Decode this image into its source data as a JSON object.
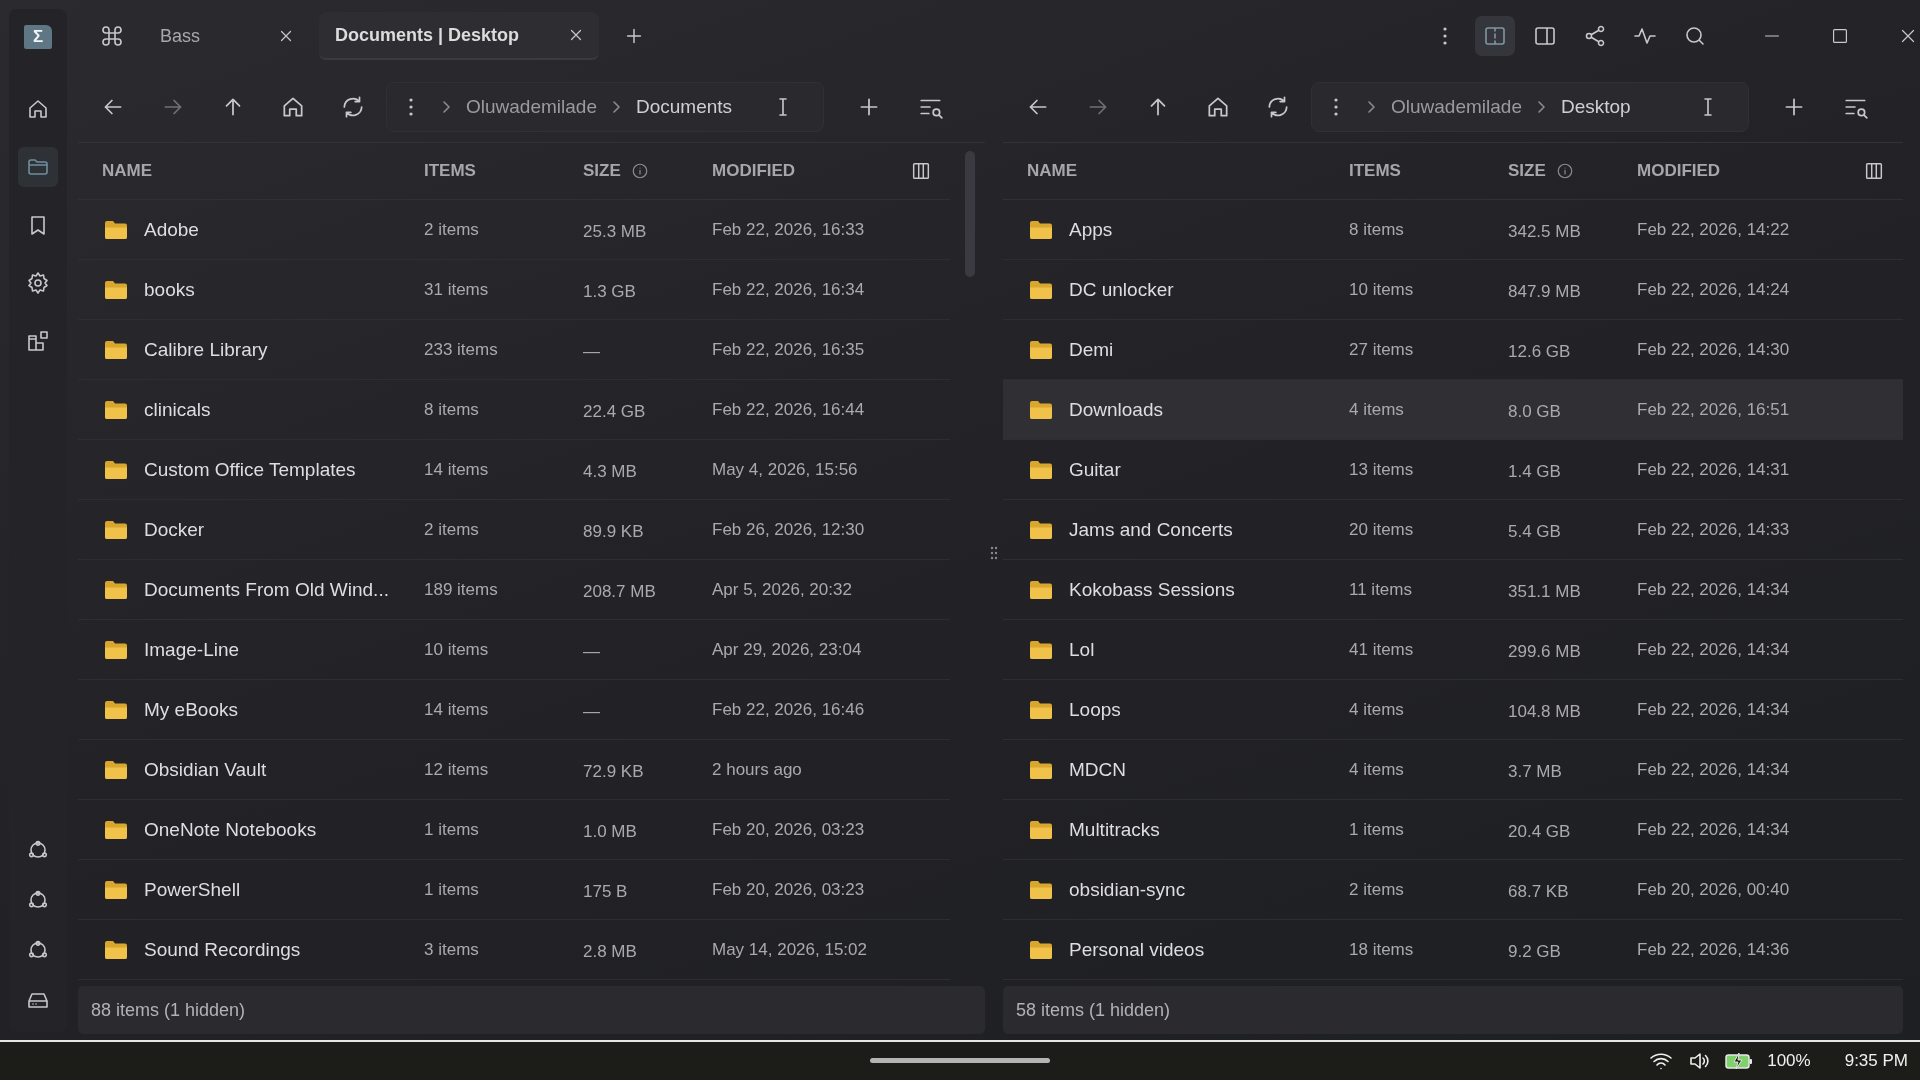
{
  "app": {
    "logo": "Σ"
  },
  "tabs": [
    {
      "label": "Bass",
      "selected": false
    },
    {
      "label": "Documents | Desktop",
      "selected": true
    }
  ],
  "window_actions": [
    {
      "kind": "more",
      "selected": false
    },
    {
      "kind": "dual-pane",
      "selected": true
    },
    {
      "kind": "single-pane",
      "selected": false
    },
    {
      "kind": "share",
      "selected": false
    },
    {
      "kind": "activity",
      "selected": false
    },
    {
      "kind": "search",
      "selected": false
    }
  ],
  "sidebar": {
    "items": [
      {
        "kind": "home",
        "selected": false
      },
      {
        "kind": "folder",
        "selected": true
      },
      {
        "kind": "bookmark",
        "selected": false
      },
      {
        "kind": "settings",
        "selected": false
      },
      {
        "kind": "widgets",
        "selected": false
      }
    ],
    "bottom_items": [
      {
        "kind": "network",
        "selected": false
      },
      {
        "kind": "network",
        "selected": false
      },
      {
        "kind": "network",
        "selected": false
      },
      {
        "kind": "drive",
        "selected": false
      }
    ]
  },
  "panes": [
    {
      "breadcrumb": [
        "Oluwademilade",
        "Documents"
      ],
      "forward_disabled": true,
      "scrollbar": true,
      "columns": [
        "NAME",
        "ITEMS",
        "SIZE",
        "MODIFIED"
      ],
      "rows": [
        {
          "name": "Adobe",
          "items": "2 items",
          "size": "25.3 MB",
          "modified": "Feb 22, 2026, 16:33",
          "selected": false
        },
        {
          "name": "books",
          "items": "31 items",
          "size": "1.3 GB",
          "modified": "Feb 22, 2026, 16:34",
          "selected": false
        },
        {
          "name": "Calibre Library",
          "items": "233 items",
          "size": "—",
          "modified": "Feb 22, 2026, 16:35",
          "selected": false
        },
        {
          "name": "clinicals",
          "items": "8 items",
          "size": "22.4 GB",
          "modified": "Feb 22, 2026, 16:44",
          "selected": false
        },
        {
          "name": "Custom Office Templates",
          "items": "14 items",
          "size": "4.3 MB",
          "modified": "May 4, 2026, 15:56",
          "selected": false
        },
        {
          "name": "Docker",
          "items": "2 items",
          "size": "89.9 KB",
          "modified": "Feb 26, 2026, 12:30",
          "selected": false
        },
        {
          "name": "Documents From Old Wind...",
          "items": "189 items",
          "size": "208.7 MB",
          "modified": "Apr 5, 2026, 20:32",
          "selected": false
        },
        {
          "name": "Image-Line",
          "items": "10 items",
          "size": "—",
          "modified": "Apr 29, 2026, 23:04",
          "selected": false
        },
        {
          "name": "My eBooks",
          "items": "14 items",
          "size": "—",
          "modified": "Feb 22, 2026, 16:46",
          "selected": false
        },
        {
          "name": "Obsidian Vault",
          "items": "12 items",
          "size": "72.9 KB",
          "modified": "2 hours ago",
          "selected": false
        },
        {
          "name": "OneNote Notebooks",
          "items": "1 items",
          "size": "1.0 MB",
          "modified": "Feb 20, 2026, 03:23",
          "selected": false
        },
        {
          "name": "PowerShell",
          "items": "1 items",
          "size": "175 B",
          "modified": "Feb 20, 2026, 03:23",
          "selected": false
        },
        {
          "name": "Sound Recordings",
          "items": "3 items",
          "size": "2.8 MB",
          "modified": "May 14, 2026, 15:02",
          "selected": false
        }
      ],
      "status": "88 items (1 hidden)"
    },
    {
      "breadcrumb": [
        "Oluwademilade",
        "Desktop"
      ],
      "forward_disabled": true,
      "scrollbar": false,
      "columns": [
        "NAME",
        "ITEMS",
        "SIZE",
        "MODIFIED"
      ],
      "rows": [
        {
          "name": "Apps",
          "items": "8 items",
          "size": "342.5 MB",
          "modified": "Feb 22, 2026, 14:22",
          "selected": false
        },
        {
          "name": "DC unlocker",
          "items": "10 items",
          "size": "847.9 MB",
          "modified": "Feb 22, 2026, 14:24",
          "selected": false
        },
        {
          "name": "Demi",
          "items": "27 items",
          "size": "12.6 GB",
          "modified": "Feb 22, 2026, 14:30",
          "selected": false
        },
        {
          "name": "Downloads",
          "items": "4 items",
          "size": "8.0 GB",
          "modified": "Feb 22, 2026, 16:51",
          "selected": true
        },
        {
          "name": "Guitar",
          "items": "13 items",
          "size": "1.4 GB",
          "modified": "Feb 22, 2026, 14:31",
          "selected": false
        },
        {
          "name": "Jams and Concerts",
          "items": "20 items",
          "size": "5.4 GB",
          "modified": "Feb 22, 2026, 14:33",
          "selected": false
        },
        {
          "name": "Kokobass Sessions",
          "items": "11 items",
          "size": "351.1 MB",
          "modified": "Feb 22, 2026, 14:34",
          "selected": false
        },
        {
          "name": "Lol",
          "items": "41 items",
          "size": "299.6 MB",
          "modified": "Feb 22, 2026, 14:34",
          "selected": false
        },
        {
          "name": "Loops",
          "items": "4 items",
          "size": "104.8 MB",
          "modified": "Feb 22, 2026, 14:34",
          "selected": false
        },
        {
          "name": "MDCN",
          "items": "4 items",
          "size": "3.7 MB",
          "modified": "Feb 22, 2026, 14:34",
          "selected": false
        },
        {
          "name": "Multitracks",
          "items": "1 items",
          "size": "20.4 GB",
          "modified": "Feb 22, 2026, 14:34",
          "selected": false
        },
        {
          "name": "obsidian-sync",
          "items": "2 items",
          "size": "68.7 KB",
          "modified": "Feb 20, 2026, 00:40",
          "selected": false
        },
        {
          "name": "Personal videos",
          "items": "18 items",
          "size": "9.2 GB",
          "modified": "Feb 22, 2026, 14:36",
          "selected": false
        }
      ],
      "status": "58 items (1 hidden)"
    }
  ],
  "taskbar": {
    "battery": "100%",
    "time": "9:35 PM"
  }
}
